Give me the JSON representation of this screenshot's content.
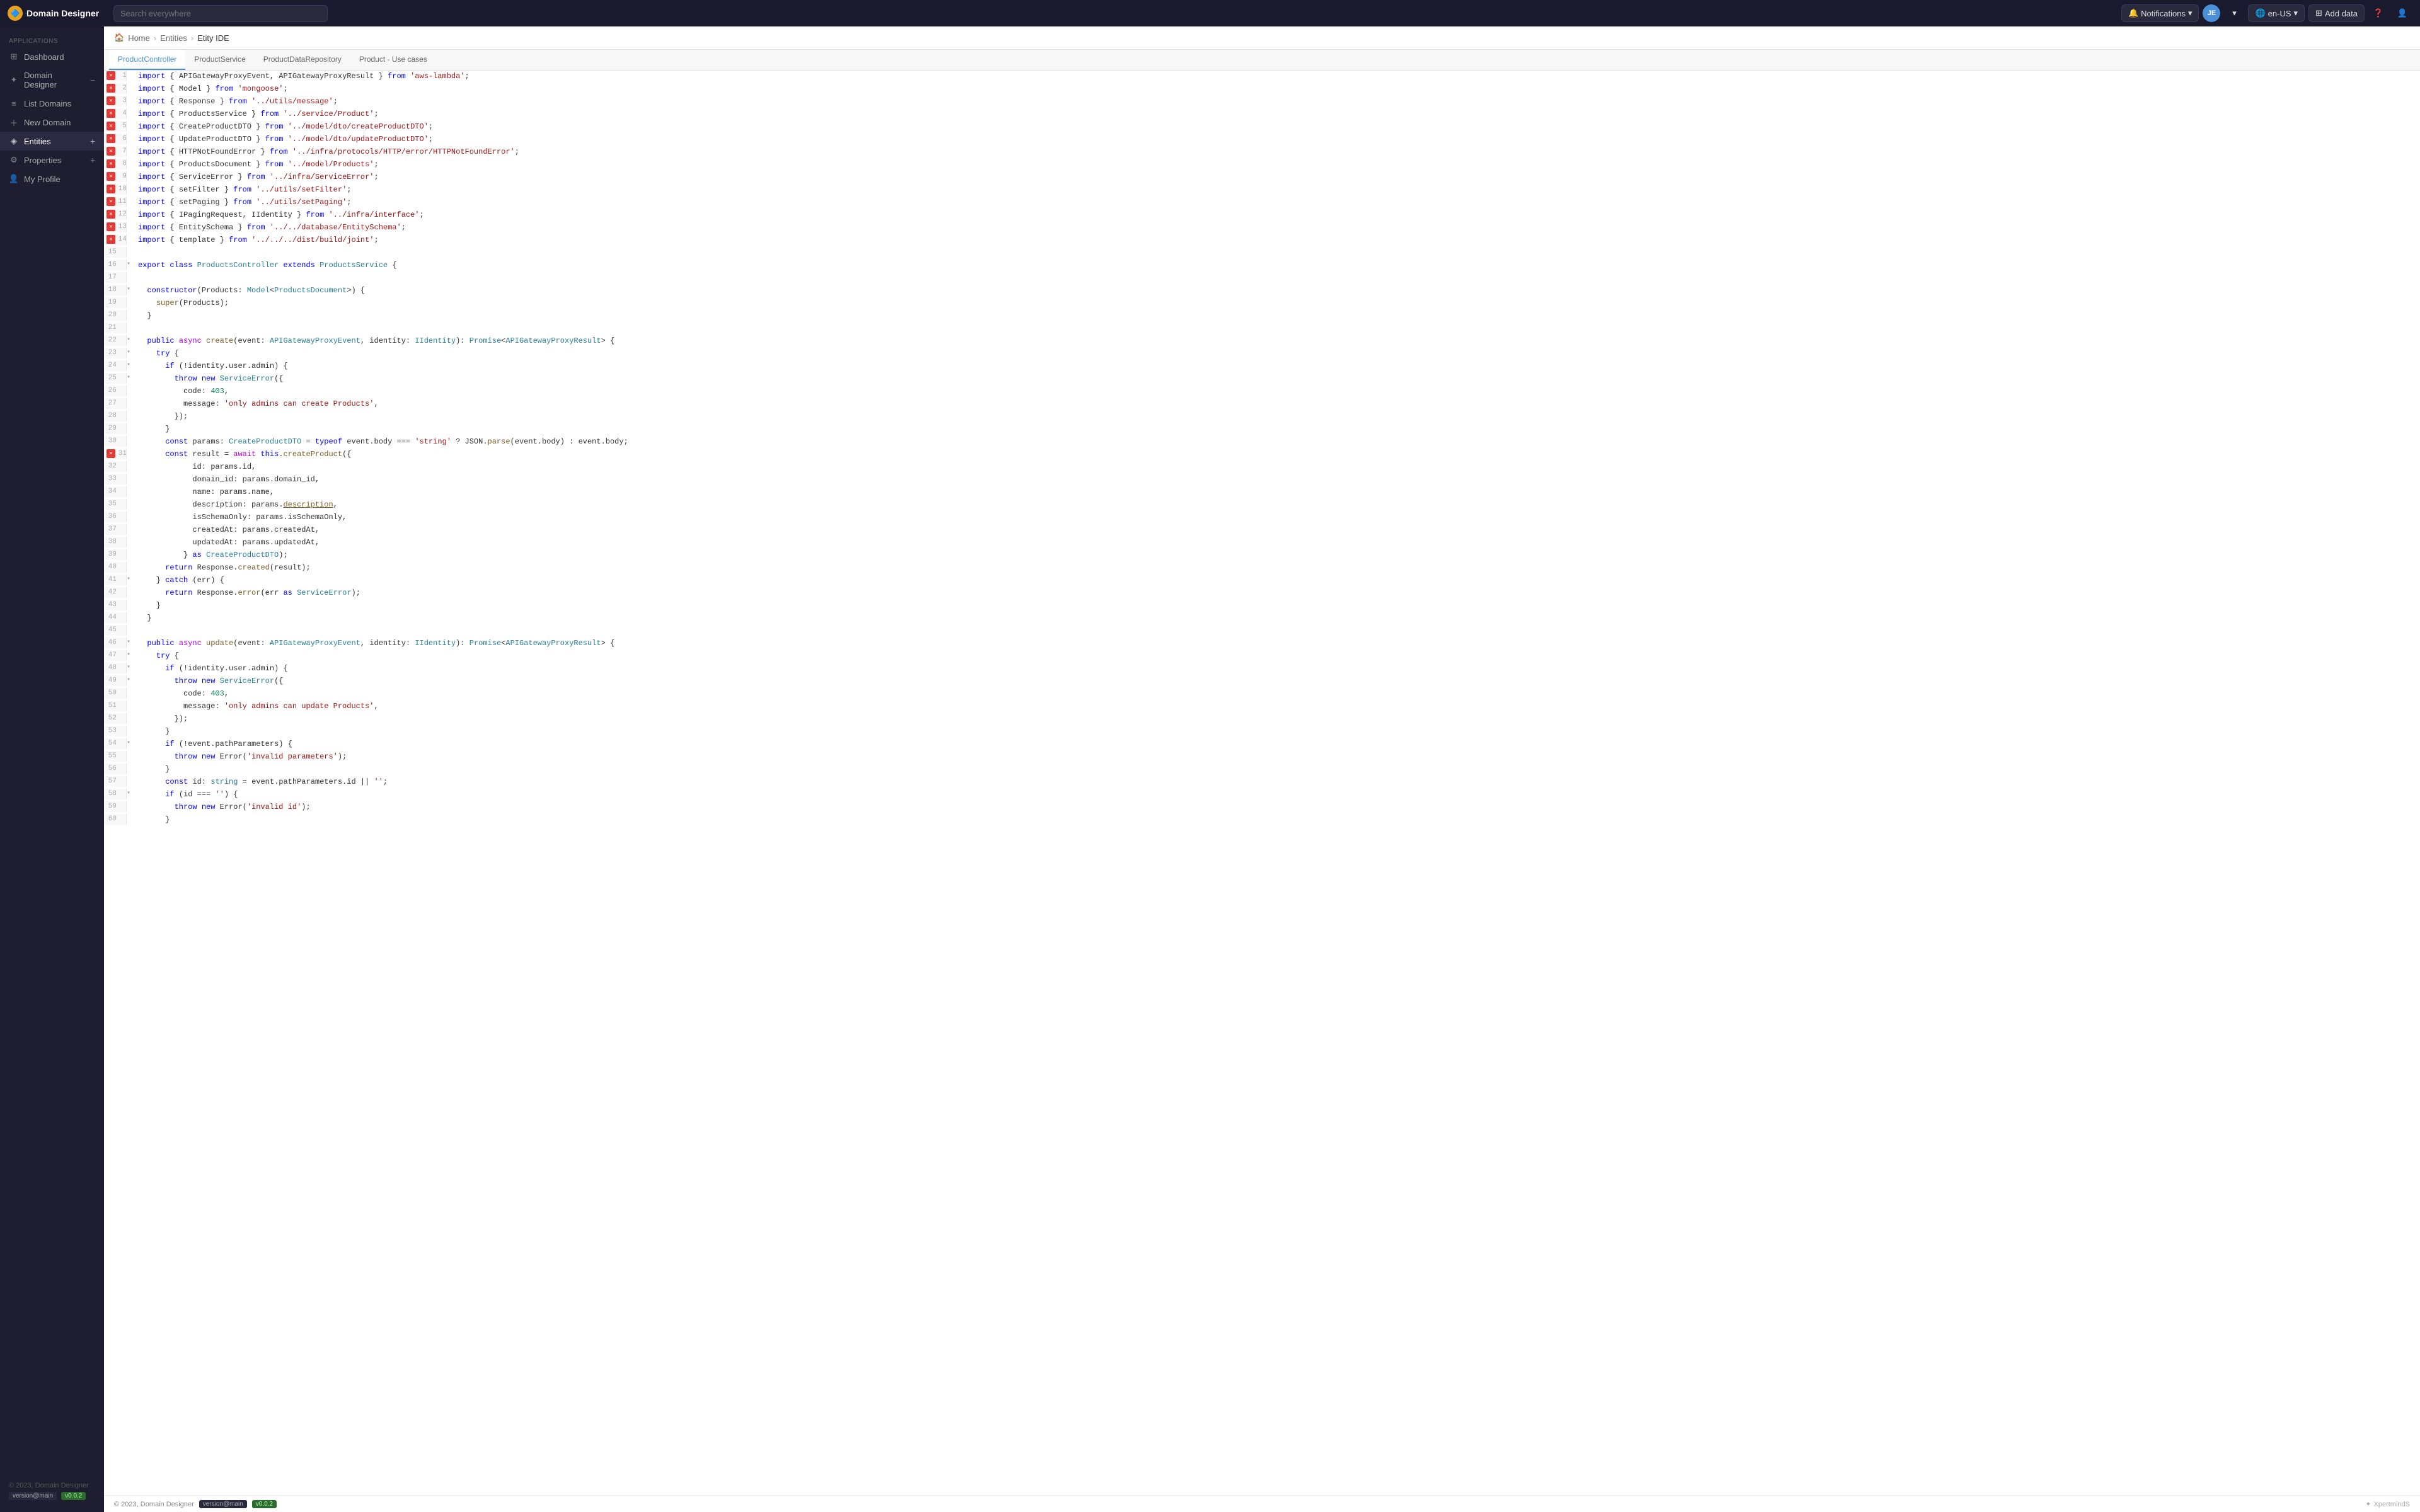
{
  "navbar": {
    "brand": "Domain Designer",
    "search_placeholder": "Search everywhere",
    "notifications_label": "Notifications",
    "avatar_initials": "JE",
    "lang_label": "en-US",
    "add_data_label": "Add data"
  },
  "sidebar": {
    "section_label": "APPLICATIONS",
    "items": [
      {
        "id": "dashboard",
        "label": "Dashboard",
        "icon": "grid"
      },
      {
        "id": "domain-designer",
        "label": "Domain Designer",
        "icon": "star",
        "has_toggle": true
      },
      {
        "id": "list-domains",
        "label": "List Domains",
        "icon": "list"
      },
      {
        "id": "new-domain",
        "label": "New Domain",
        "icon": "plus-circle"
      },
      {
        "id": "entities",
        "label": "Entities",
        "icon": "entity",
        "has_add": true
      },
      {
        "id": "properties",
        "label": "Properties",
        "icon": "properties",
        "has_add": true
      },
      {
        "id": "my-profile",
        "label": "My Profile",
        "icon": "user"
      }
    ],
    "footer_copy": "© 2023, Domain Designer",
    "version_label": "version@main",
    "version_num": "v0.0.2"
  },
  "breadcrumb": {
    "home_label": "Home",
    "entities_label": "Entities",
    "current_label": "Etity IDE"
  },
  "tabs": [
    {
      "id": "product-controller",
      "label": "ProductController",
      "active": true
    },
    {
      "id": "product-service",
      "label": "ProductService",
      "active": false
    },
    {
      "id": "product-data-repository",
      "label": "ProductDataRepository",
      "active": false
    },
    {
      "id": "product-use-cases",
      "label": "Product - Use cases",
      "active": false
    }
  ],
  "code": {
    "lines": [
      {
        "num": 1,
        "has_error": true,
        "has_expand": false,
        "content": "import { APIGatewayProxyEvent, APIGatewayProxyResult } from 'aws-lambda';"
      },
      {
        "num": 2,
        "has_error": true,
        "has_expand": false,
        "content": "import { Model } from 'mongoose';"
      },
      {
        "num": 3,
        "has_error": true,
        "has_expand": false,
        "content": "import { Response } from '../utils/message';"
      },
      {
        "num": 4,
        "has_error": true,
        "has_expand": false,
        "content": "import { ProductsService } from '../service/Product';"
      },
      {
        "num": 5,
        "has_error": true,
        "has_expand": false,
        "content": "import { CreateProductDTO } from '../model/dto/createProductDTO';"
      },
      {
        "num": 6,
        "has_error": true,
        "has_expand": false,
        "content": "import { UpdateProductDTO } from '../model/dto/updateProductDTO';"
      },
      {
        "num": 7,
        "has_error": true,
        "has_expand": false,
        "content": "import { HTTPNotFoundError } from '../infra/protocols/HTTP/error/HTTPNotFoundError';"
      },
      {
        "num": 8,
        "has_error": true,
        "has_expand": false,
        "content": "import { ProductsDocument } from '../model/Products';"
      },
      {
        "num": 9,
        "has_error": true,
        "has_expand": false,
        "content": "import { ServiceError } from '../infra/ServiceError';"
      },
      {
        "num": 10,
        "has_error": true,
        "has_expand": false,
        "content": "import { setFilter } from '../utils/setFilter';"
      },
      {
        "num": 11,
        "has_error": true,
        "has_expand": false,
        "content": "import { setPaging } from '../utils/setPaging';"
      },
      {
        "num": 12,
        "has_error": true,
        "has_expand": false,
        "content": "import { IPagingRequest, IIdentity } from '../infra/interface';"
      },
      {
        "num": 13,
        "has_error": true,
        "has_expand": false,
        "content": "import { EntitySchema } from '../../database/EntitySchema';"
      },
      {
        "num": 14,
        "has_error": true,
        "has_expand": false,
        "content": "import { template } from '../../../dist/build/joint';"
      },
      {
        "num": 15,
        "has_error": false,
        "has_expand": false,
        "content": ""
      },
      {
        "num": 16,
        "has_error": false,
        "has_expand": true,
        "content": "export class ProductsController extends ProductsService {"
      },
      {
        "num": 17,
        "has_error": false,
        "has_expand": false,
        "content": ""
      },
      {
        "num": 18,
        "has_error": false,
        "has_expand": true,
        "content": "  constructor(Products: Model<ProductsDocument>) {"
      },
      {
        "num": 19,
        "has_error": false,
        "has_expand": false,
        "content": "    super(Products);"
      },
      {
        "num": 20,
        "has_error": false,
        "has_expand": false,
        "content": "  }"
      },
      {
        "num": 21,
        "has_error": false,
        "has_expand": false,
        "content": ""
      },
      {
        "num": 22,
        "has_error": false,
        "has_expand": true,
        "content": "  public async create(event: APIGatewayProxyEvent, identity: IIdentity): Promise<APIGatewayProxyResult> {"
      },
      {
        "num": 23,
        "has_error": false,
        "has_expand": true,
        "content": "    try {"
      },
      {
        "num": 24,
        "has_error": false,
        "has_expand": true,
        "content": "      if (!identity.user.admin) {"
      },
      {
        "num": 25,
        "has_error": false,
        "has_expand": true,
        "content": "        throw new ServiceError({"
      },
      {
        "num": 26,
        "has_error": false,
        "has_expand": false,
        "content": "          code: 403,"
      },
      {
        "num": 27,
        "has_error": false,
        "has_expand": false,
        "content": "          message: 'only admins can create Products',"
      },
      {
        "num": 28,
        "has_error": false,
        "has_expand": false,
        "content": "        });"
      },
      {
        "num": 29,
        "has_error": false,
        "has_expand": false,
        "content": "      }"
      },
      {
        "num": 30,
        "has_error": false,
        "has_expand": false,
        "content": "      const params: CreateProductDTO = typeof event.body === 'string' ? JSON.parse(event.body) : event.body;"
      },
      {
        "num": 31,
        "has_error": true,
        "has_expand": false,
        "content": "      const result = await this.createProduct({"
      },
      {
        "num": 32,
        "has_error": false,
        "has_expand": false,
        "content": "            id: params.id,"
      },
      {
        "num": 33,
        "has_error": false,
        "has_expand": false,
        "content": "            domain_id: params.domain_id,"
      },
      {
        "num": 34,
        "has_error": false,
        "has_expand": false,
        "content": "            name: params.name,"
      },
      {
        "num": 35,
        "has_error": false,
        "has_expand": false,
        "content": "            description: params.description,"
      },
      {
        "num": 36,
        "has_error": false,
        "has_expand": false,
        "content": "            isSchemaOnly: params.isSchemaOnly,"
      },
      {
        "num": 37,
        "has_error": false,
        "has_expand": false,
        "content": "            createdAt: params.createdAt,"
      },
      {
        "num": 38,
        "has_error": false,
        "has_expand": false,
        "content": "            updatedAt: params.updatedAt,"
      },
      {
        "num": 39,
        "has_error": false,
        "has_expand": false,
        "content": "          } as CreateProductDTO);"
      },
      {
        "num": 40,
        "has_error": false,
        "has_expand": false,
        "content": "      return Response.created(result);"
      },
      {
        "num": 41,
        "has_error": false,
        "has_expand": true,
        "content": "    } catch (err) {"
      },
      {
        "num": 42,
        "has_error": false,
        "has_expand": false,
        "content": "      return Response.error(err as ServiceError);"
      },
      {
        "num": 43,
        "has_error": false,
        "has_expand": false,
        "content": "    }"
      },
      {
        "num": 44,
        "has_error": false,
        "has_expand": false,
        "content": "  }"
      },
      {
        "num": 45,
        "has_error": false,
        "has_expand": false,
        "content": ""
      },
      {
        "num": 46,
        "has_error": false,
        "has_expand": true,
        "content": "  public async update(event: APIGatewayProxyEvent, identity: IIdentity): Promise<APIGatewayProxyResult> {"
      },
      {
        "num": 47,
        "has_error": false,
        "has_expand": true,
        "content": "    try {"
      },
      {
        "num": 48,
        "has_error": false,
        "has_expand": true,
        "content": "      if (!identity.user.admin) {"
      },
      {
        "num": 49,
        "has_error": false,
        "has_expand": true,
        "content": "        throw new ServiceError({"
      },
      {
        "num": 50,
        "has_error": false,
        "has_expand": false,
        "content": "          code: 403,"
      },
      {
        "num": 51,
        "has_error": false,
        "has_expand": false,
        "content": "          message: 'only admins can update Products',"
      },
      {
        "num": 52,
        "has_error": false,
        "has_expand": false,
        "content": "        });"
      },
      {
        "num": 53,
        "has_error": false,
        "has_expand": false,
        "content": "      }"
      },
      {
        "num": 54,
        "has_error": false,
        "has_expand": true,
        "content": "      if (!event.pathParameters) {"
      },
      {
        "num": 55,
        "has_error": false,
        "has_expand": false,
        "content": "        throw new Error('invalid parameters');"
      },
      {
        "num": 56,
        "has_error": false,
        "has_expand": false,
        "content": "      }"
      },
      {
        "num": 57,
        "has_error": false,
        "has_expand": false,
        "content": "      const id: string = event.pathParameters.id || '';"
      },
      {
        "num": 58,
        "has_error": false,
        "has_expand": true,
        "content": "      if (id === '') {"
      },
      {
        "num": 59,
        "has_error": false,
        "has_expand": false,
        "content": "        throw new Error('invalid id');"
      },
      {
        "num": 60,
        "has_error": false,
        "has_expand": false,
        "content": "      }"
      }
    ]
  },
  "footer": {
    "copy": "© 2023, Domain Designer",
    "version_label": "version@main",
    "version_num": "v0.0.2",
    "brand": "XpertmindS"
  }
}
